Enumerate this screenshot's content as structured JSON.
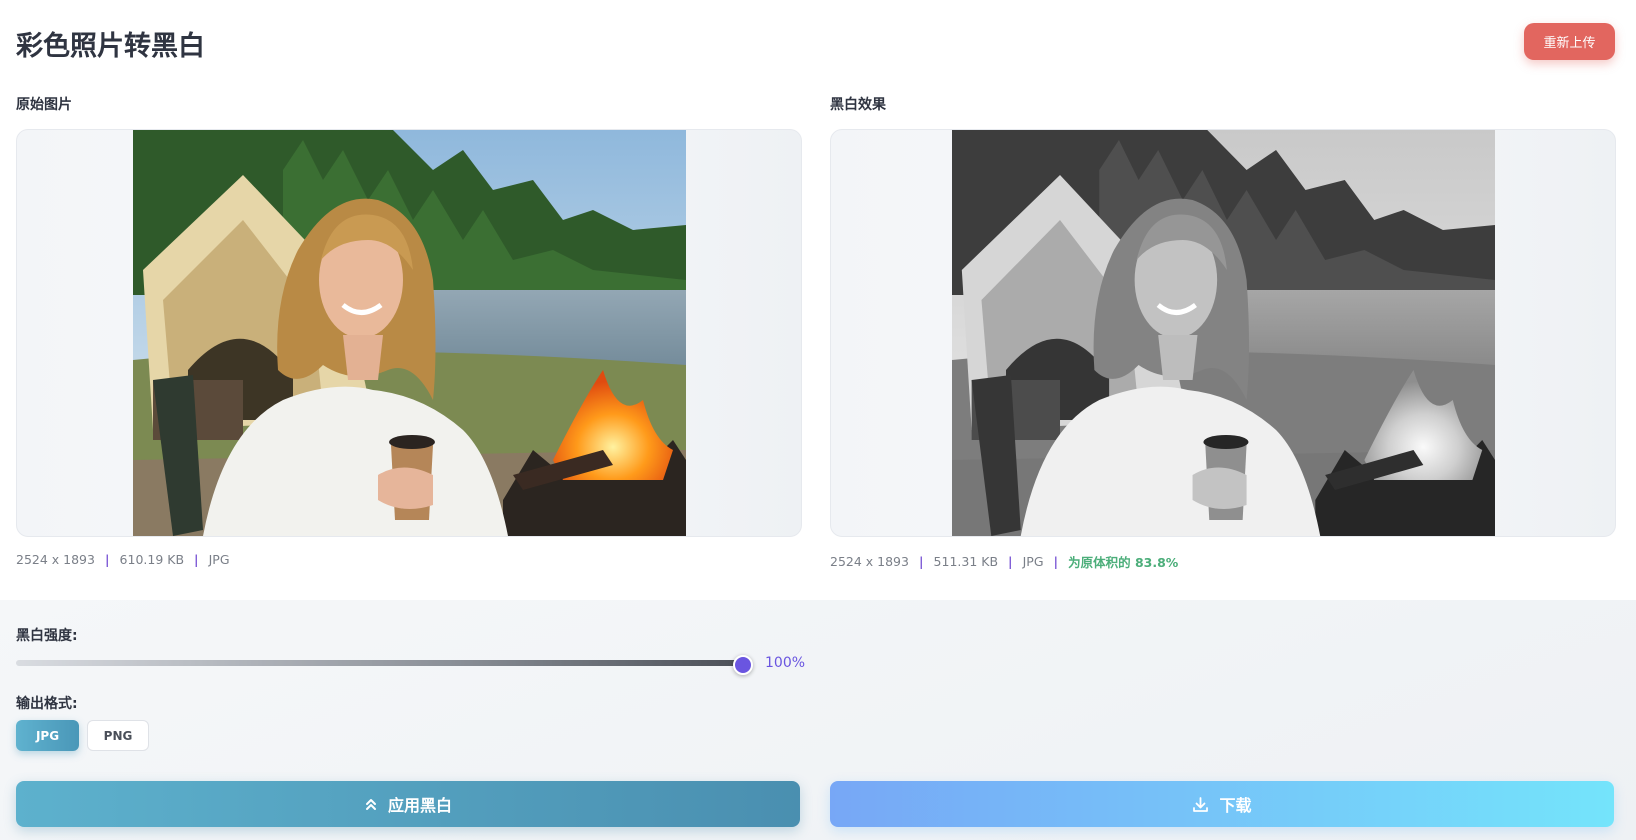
{
  "header": {
    "title": "彩色照片转黑白",
    "reupload_label": "重新上传"
  },
  "original": {
    "label": "原始图片",
    "dimensions": "2524 x 1893",
    "size": "610.19 KB",
    "format": "JPG"
  },
  "result": {
    "label": "黑白效果",
    "dimensions": "2524 x 1893",
    "size": "511.31 KB",
    "format": "JPG",
    "ratio_text": "为原体积的 83.8%"
  },
  "controls": {
    "intensity_label": "黑白强度:",
    "intensity_value": "100%",
    "intensity_fraction": 1.0,
    "format_label": "输出格式:",
    "formats": [
      "JPG",
      "PNG"
    ],
    "selected_format": "JPG"
  },
  "actions": {
    "apply_label": "应用黑白",
    "download_label": "下载"
  },
  "colors": {
    "accent": "#6a55e0",
    "reupload": "#e2665f",
    "ratio": "#4cae7a",
    "separator": "#7e5bd6"
  },
  "icons": {
    "apply": "double-chevron-up-icon",
    "download": "download-icon"
  }
}
